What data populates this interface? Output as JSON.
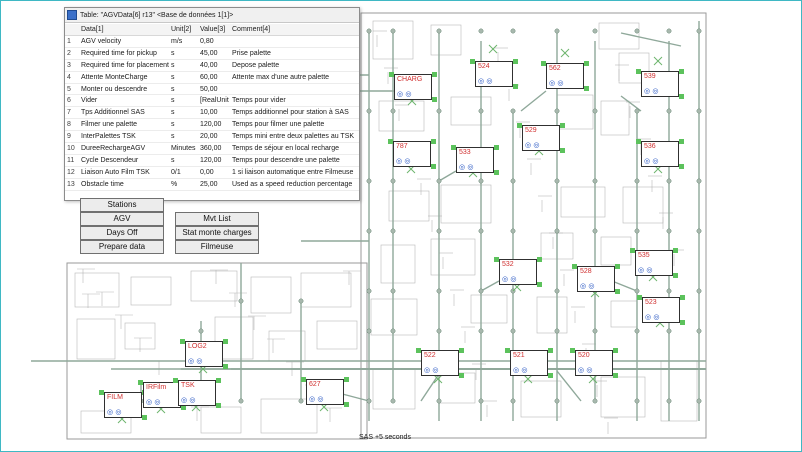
{
  "window": {
    "title": "Table: \"AGVData[6] r13\" <Base de données 1[1]>"
  },
  "table": {
    "headers": [
      "",
      "Data[1]",
      "Unit[2]",
      "Value[3]",
      "Comment[4]"
    ],
    "rows": [
      [
        "1",
        "AGV velocity",
        "m/s",
        "0,80",
        ""
      ],
      [
        "2",
        "Required time for pickup",
        "s",
        "45,00",
        "Prise palette"
      ],
      [
        "3",
        "Required time for placement",
        "s",
        "40,00",
        "Depose palette"
      ],
      [
        "4",
        "Attente MonteCharge",
        "s",
        "60,00",
        "Attente max d'une autre palette"
      ],
      [
        "5",
        "Monter ou descendre",
        "s",
        "50,00",
        ""
      ],
      [
        "6",
        "Vider",
        "s",
        "[RealUnit",
        "Temps pour vider"
      ],
      [
        "7",
        "Tps Additionnel SAS",
        "s",
        "10,00",
        "Temps additionnel pour station à SAS"
      ],
      [
        "8",
        "Filmer une palette",
        "s",
        "120,00",
        "Temps pour filmer une palette"
      ],
      [
        "9",
        "InterPalettes TSK",
        "s",
        "20,00",
        "Temps mini entre deux palettes au TSK"
      ],
      [
        "10",
        "DureeRechargeAGV",
        "Minutes",
        "360,00",
        "Temps de séjour en local recharge"
      ],
      [
        "11",
        "Cycle Descendeur",
        "s",
        "120,00",
        "Temps pour descendre une palette"
      ],
      [
        "12",
        "Liaison Auto Film TSK",
        "0/1",
        "0,00",
        "1 si liaison automatique entre Filmeuse"
      ],
      [
        "13",
        "Obstacle time",
        "%",
        "25,00",
        "Used as a speed reduction percentage"
      ]
    ]
  },
  "buttons": {
    "stations": "Stations",
    "agv": "AGV",
    "mvt_list": "Mvt List",
    "days_off": "Days Off",
    "stat_monte_charges": "Stat monte charges",
    "prepare_data": "Prepare data",
    "filmeuse": "Filmeuse"
  },
  "stations": [
    "CHARG",
    "524",
    "562",
    "539",
    "787",
    "533",
    "529",
    "536",
    "532",
    "528",
    "535",
    "523",
    "522",
    "521",
    "520",
    "LOG2",
    "627",
    "FILM",
    "IRFilm",
    "TSK"
  ],
  "station_dots": "◎ ◎",
  "status": "SAS +5 seconds",
  "colors": {
    "accent_frame": "#3fb8c4",
    "track": "#8fa89a",
    "station_label": "#d03030",
    "node_green": "#5cc25c"
  }
}
